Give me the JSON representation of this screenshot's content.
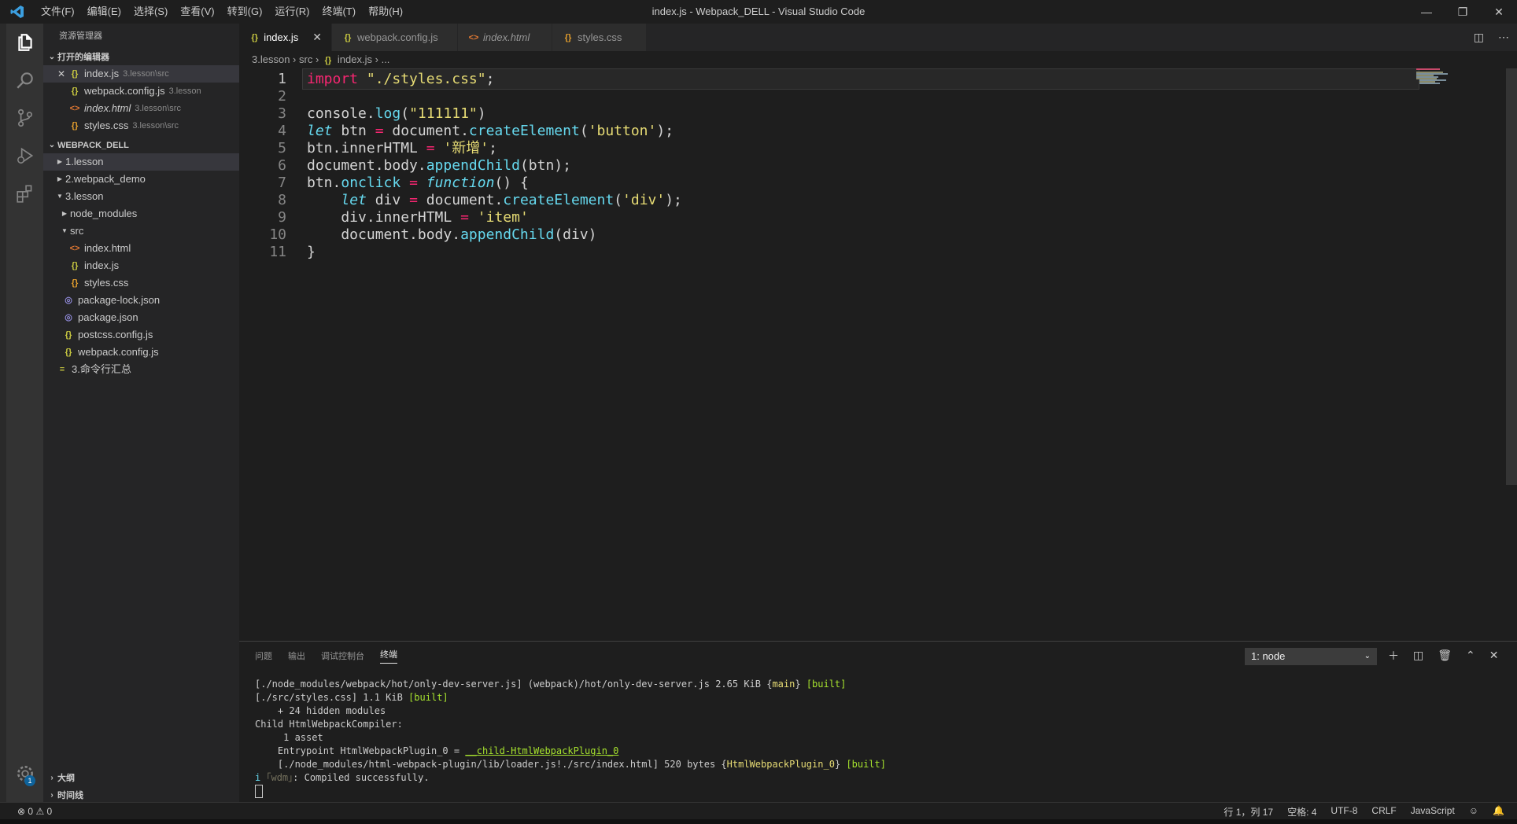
{
  "titlebar": {
    "menus": [
      "文件(F)",
      "编辑(E)",
      "选择(S)",
      "查看(V)",
      "转到(G)",
      "运行(R)",
      "终端(T)",
      "帮助(H)"
    ],
    "window_title": "index.js - Webpack_DELL - Visual Studio Code"
  },
  "activity_bar": {
    "items": [
      "files-icon",
      "search-icon",
      "source-control-icon",
      "run-debug-icon",
      "extensions-icon"
    ],
    "settings_badge": "1"
  },
  "sidebar": {
    "header": "资源管理器",
    "open_editors": {
      "title": "打开的编辑器",
      "items": [
        {
          "name": "index.js",
          "desc": "3.lesson\\src",
          "type": "js"
        },
        {
          "name": "webpack.config.js",
          "desc": "3.lesson",
          "type": "js"
        },
        {
          "name": "index.html",
          "desc": "3.lesson\\src",
          "type": "html"
        },
        {
          "name": "styles.css",
          "desc": "3.lesson\\src",
          "type": "css"
        }
      ]
    },
    "workspace": {
      "title": "WEBPACK_DELL",
      "items": [
        {
          "name": "1.lesson",
          "type": "folder"
        },
        {
          "name": "2.webpack_demo",
          "type": "folder"
        },
        {
          "name": "3.lesson",
          "type": "folder-open"
        },
        {
          "name": "node_modules",
          "type": "folder"
        },
        {
          "name": "src",
          "type": "folder-open"
        },
        {
          "name": "index.html",
          "type": "html"
        },
        {
          "name": "index.js",
          "type": "js"
        },
        {
          "name": "styles.css",
          "type": "css"
        },
        {
          "name": "package-lock.json",
          "type": "json"
        },
        {
          "name": "package.json",
          "type": "json"
        },
        {
          "name": "postcss.config.js",
          "type": "js"
        },
        {
          "name": "webpack.config.js",
          "type": "js"
        },
        {
          "name": "3.命令行汇总",
          "type": "md"
        }
      ]
    },
    "outline_title": "大纲",
    "timeline_title": "时间线"
  },
  "tabs": [
    {
      "label": "index.js",
      "type": "js",
      "active": true
    },
    {
      "label": "webpack.config.js",
      "type": "js"
    },
    {
      "label": "index.html",
      "type": "html"
    },
    {
      "label": "styles.css",
      "type": "css"
    }
  ],
  "breadcrumb": [
    "3.lesson",
    "src",
    "index.js",
    "..."
  ],
  "code": {
    "line_numbers": [
      "1",
      "2",
      "3",
      "4",
      "5",
      "6",
      "7",
      "8",
      "9",
      "10",
      "11"
    ],
    "lines": [
      "import \"./styles.css\";",
      "",
      "console.log(\"111111\")",
      "let btn = document.createElement('button');",
      "btn.innerHTML = '新增';",
      "document.body.appendChild(btn);",
      "btn.onclick = function() {",
      "    let div = document.createElement('div');",
      "    div.innerHTML = 'item'",
      "    document.body.appendChild(div)",
      "}"
    ]
  },
  "panel": {
    "tabs": [
      "问题",
      "输出",
      "调试控制台",
      "终端"
    ],
    "active_tab": "终端",
    "terminal_select": "1: node",
    "terminal_lines": [
      "[./node_modules/webpack/hot/only-dev-server.js] (webpack)/hot/only-dev-server.js 2.65 KiB {main} [built]",
      "[./src/styles.css] 1.1 KiB [built]",
      "    + 24 hidden modules",
      "Child HtmlWebpackCompiler:",
      "     1 asset",
      "    Entrypoint HtmlWebpackPlugin_0 = __child-HtmlWebpackPlugin_0",
      "    [./node_modules/html-webpack-plugin/lib/loader.js!./src/index.html] 520 bytes {HtmlWebpackPlugin_0} [built]",
      "i ｢wdm｣: Compiled successfully."
    ]
  },
  "statusbar": {
    "errors": "0",
    "warnings": "0",
    "position": "行 1，列 17",
    "spaces": "空格: 4",
    "encoding": "UTF-8",
    "eol": "CRLF",
    "language": "JavaScript"
  }
}
